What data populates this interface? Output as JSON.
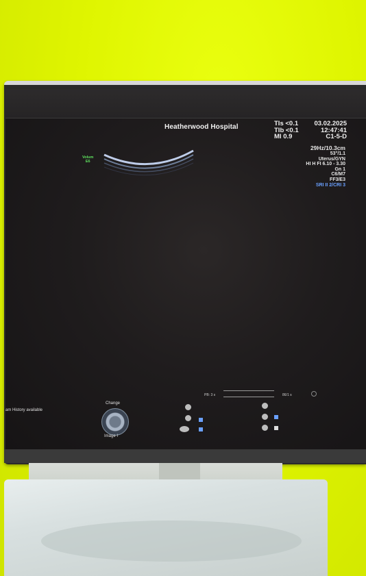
{
  "screen": {
    "hospital": "Heatherwood Hospital",
    "tis": "TIs <0.1",
    "tib": "TIb <0.1",
    "mi": "MI 0.9",
    "date": "03.02.2025",
    "time": "12:47:41",
    "probe": "C1-5-D",
    "frame_rate": "29Hz/10.3cm",
    "angle": "53°/1.1",
    "preset": "Uterus/GYN",
    "harmonic": "HI H FI 6.10 - 3.30",
    "gain": "Gn 1",
    "map": "C6/M7",
    "ff": "FF3/E3",
    "sri": "SRI II 2/CRI 3",
    "volume_label": "Volum",
    "volume_value": "E6",
    "footer_history": "am History available",
    "knob_top": "Change",
    "knob_bottom": "Image I",
    "slider_left": "PB: 3 s",
    "slider_right": "86/1 s"
  }
}
